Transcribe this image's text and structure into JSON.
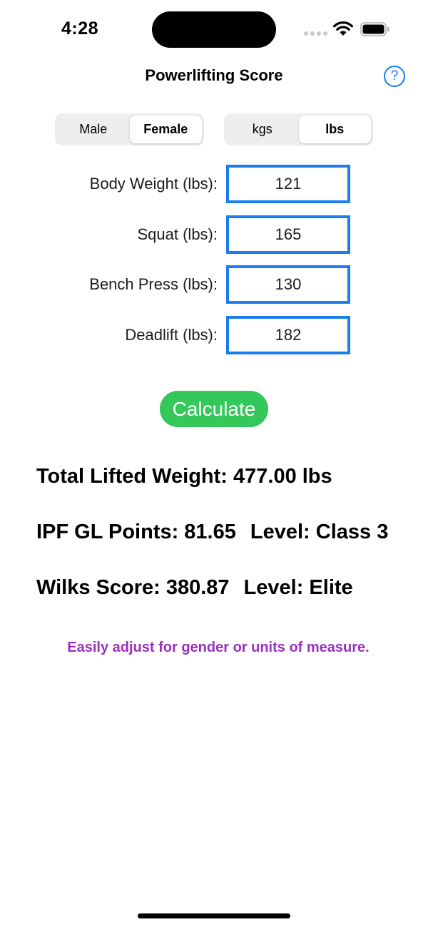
{
  "status_bar": {
    "time": "4:28"
  },
  "nav": {
    "title": "Powerlifting Score",
    "help_label": "?"
  },
  "gender": {
    "options": [
      "Male",
      "Female"
    ],
    "selected": "Female"
  },
  "units": {
    "options": [
      "kgs",
      "lbs"
    ],
    "selected": "lbs"
  },
  "form": {
    "fields": [
      {
        "label": "Body Weight (lbs):",
        "value": "121"
      },
      {
        "label": "Squat (lbs):",
        "value": "165"
      },
      {
        "label": "Bench Press (lbs):",
        "value": "130"
      },
      {
        "label": "Deadlift (lbs):",
        "value": "182"
      }
    ]
  },
  "calculate_label": "Calculate",
  "results": {
    "total": "Total Lifted Weight: 477.00 lbs",
    "ipf_points": "IPF GL Points: 81.65",
    "ipf_level": "Level: Class 3",
    "wilks_score": "Wilks Score: 380.87",
    "wilks_level": "Level: Elite"
  },
  "tip": "Easily adjust for gender or units of measure.",
  "colors": {
    "accent_blue": "#1a7cf2",
    "calculate_green": "#34c759",
    "tip_purple": "#9b2fbe"
  },
  "icons": {
    "help": "question-circle-icon",
    "wifi": "wifi-icon",
    "battery": "battery-icon"
  }
}
